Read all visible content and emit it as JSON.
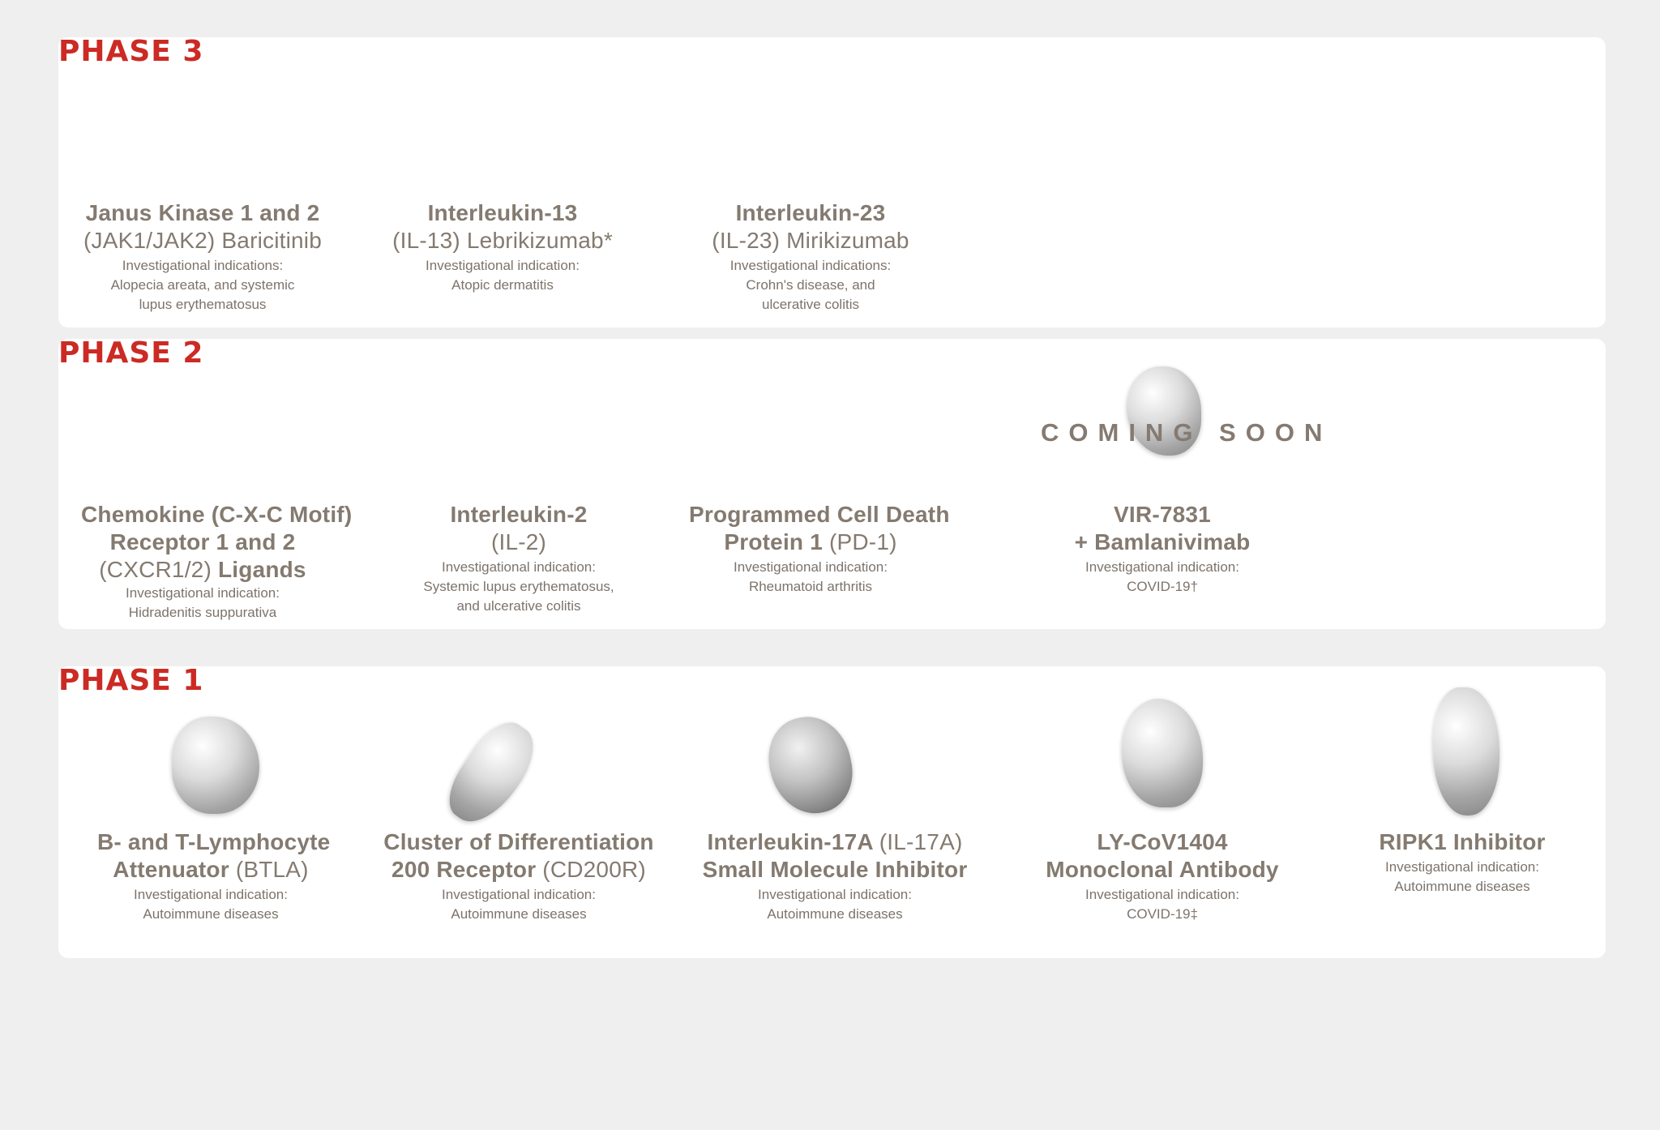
{
  "phases": [
    {
      "title": "PHASE 3",
      "items": [
        {
          "title_bold_line1": "Janus Kinase 1 and 2",
          "title_line2": "(JAK1/JAK2) Baricitinib",
          "ind_label": "Investigational indications:",
          "ind_line1": "Alopecia areata, and systemic",
          "ind_line2": "lupus erythematosus"
        },
        {
          "title_bold_line1": "Interleukin-13",
          "title_line2": "(IL-13) Lebrikizumab*",
          "ind_label": "Investigational indication:",
          "ind_line1": "Atopic dermatitis",
          "ind_line2": ""
        },
        {
          "title_bold_line1": "Interleukin-23",
          "title_line2": "(IL-23) Mirikizumab",
          "ind_label": "Investigational indications:",
          "ind_line1": "Crohn's disease, and",
          "ind_line2": "ulcerative colitis"
        }
      ]
    },
    {
      "title": "PHASE 2",
      "coming_soon": "COMING SOON",
      "items": [
        {
          "line1": "Chemokine (C-X-C Motif)",
          "line2": "Receptor 1 and 2",
          "line3_light": "(CXCR1/2) ",
          "line3_bold": "Ligands",
          "ind_label": "Investigational indication:",
          "ind_line1": "Hidradenitis suppurativa",
          "ind_line2": ""
        },
        {
          "line1": "Interleukin-2",
          "line2_light": "(IL-2)",
          "ind_label": "Investigational indication:",
          "ind_line1": "Systemic lupus erythematosus,",
          "ind_line2": "and ulcerative colitis"
        },
        {
          "line1": "Programmed Cell Death",
          "line2_bold": "Protein 1 ",
          "line2_light": "(PD-1)",
          "ind_label": "Investigational indication:",
          "ind_line1": "Rheumatoid arthritis",
          "ind_line2": ""
        },
        {
          "line1": "VIR-7831",
          "line2": "+ Bamlanivimab",
          "ind_label": "Investigational indication:",
          "ind_line1": "COVID-19†",
          "ind_line2": ""
        }
      ]
    },
    {
      "title": "PHASE 1",
      "items": [
        {
          "line1": "B- and T-Lymphocyte",
          "line2_bold": "Attenuator ",
          "line2_light": "(BTLA)",
          "ind_label": "Investigational indication:",
          "ind_line1": "Autoimmune diseases"
        },
        {
          "line1": "Cluster of Differentiation",
          "line2_bold": "200 Receptor ",
          "line2_light": "(CD200R)",
          "ind_label": "Investigational indication:",
          "ind_line1": "Autoimmune diseases"
        },
        {
          "line1_bold": "Interleukin-17A ",
          "line1_light": "(IL-17A)",
          "line2": "Small Molecule Inhibitor",
          "ind_label": "Investigational indication:",
          "ind_line1": "Autoimmune diseases"
        },
        {
          "line1": "LY-CoV1404",
          "line2": "Monoclonal Antibody",
          "ind_label": "Investigational indication:",
          "ind_line1": "COVID-19‡"
        },
        {
          "line1": "RIPK1 Inhibitor",
          "ind_label": "Investigational indication:",
          "ind_line1": "Autoimmune diseases"
        }
      ]
    }
  ]
}
